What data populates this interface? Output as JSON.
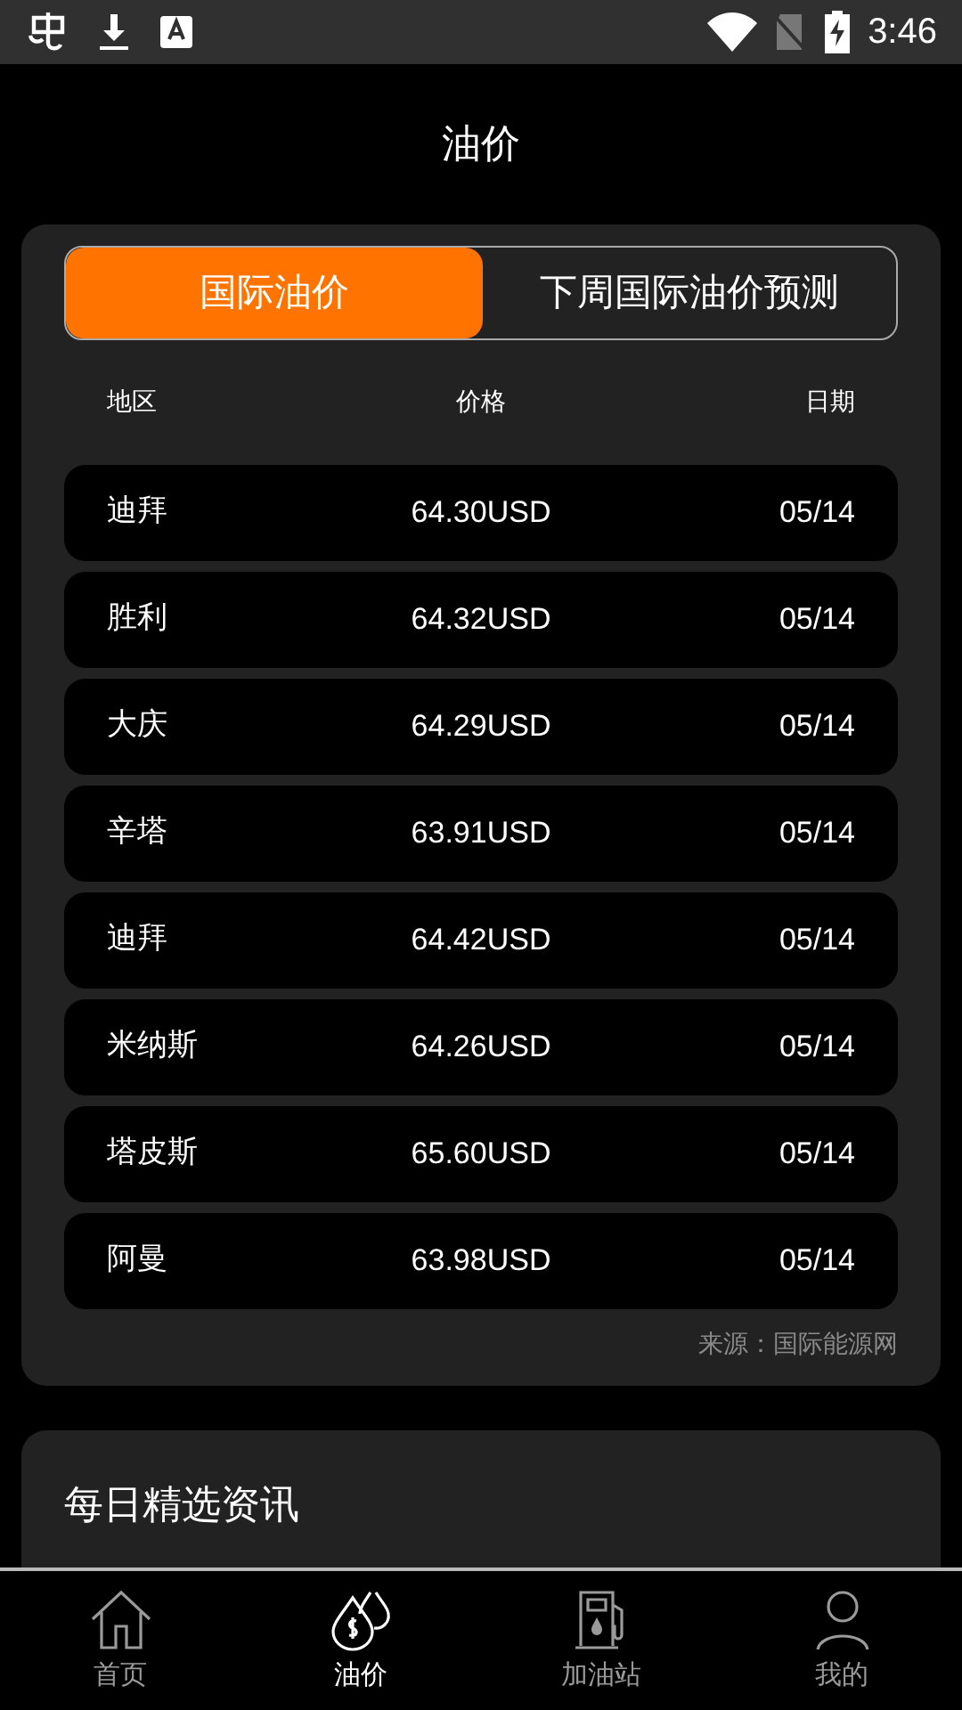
{
  "status_bar": {
    "time": "3:46"
  },
  "header": {
    "title": "油价"
  },
  "tabs": [
    {
      "label": "国际油价",
      "selected": true
    },
    {
      "label": "下周国际油价预测",
      "selected": false
    }
  ],
  "table": {
    "columns": [
      "地区",
      "价格",
      "日期"
    ],
    "rows": [
      [
        "迪拜",
        "64.30USD",
        "05/14"
      ],
      [
        "胜利",
        "64.32USD",
        "05/14"
      ],
      [
        "大庆",
        "64.29USD",
        "05/14"
      ],
      [
        "辛塔",
        "63.91USD",
        "05/14"
      ],
      [
        "迪拜",
        "64.42USD",
        "05/14"
      ],
      [
        "米纳斯",
        "64.26USD",
        "05/14"
      ],
      [
        "塔皮斯",
        "65.60USD",
        "05/14"
      ],
      [
        "阿曼",
        "63.98USD",
        "05/14"
      ]
    ]
  },
  "source": "来源：国际能源网",
  "news": {
    "title": "每日精选资讯"
  },
  "bottom_nav": [
    {
      "label": "首页",
      "kind": "home",
      "selected": false
    },
    {
      "label": "油价",
      "kind": "price",
      "selected": true
    },
    {
      "label": "加油站",
      "kind": "station",
      "selected": false
    },
    {
      "label": "我的",
      "kind": "profile",
      "selected": false
    }
  ]
}
